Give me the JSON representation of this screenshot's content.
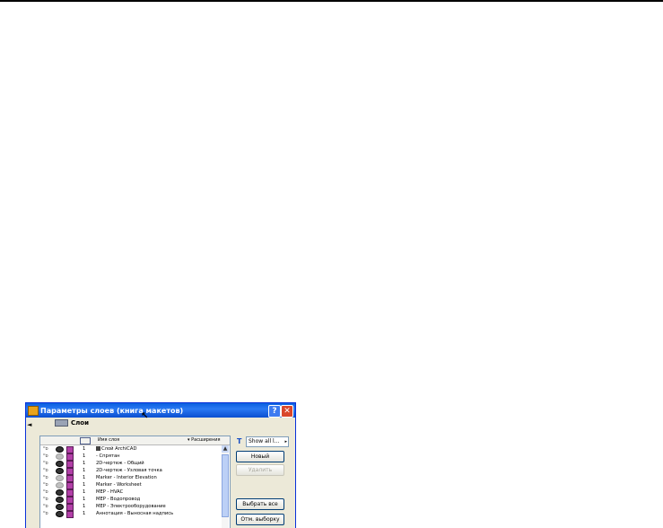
{
  "dialog": {
    "title": "Параметры слоев (книга макетов)",
    "help_label": "?",
    "close_label": "✕"
  },
  "panel": {
    "collapse_label": "◄",
    "layers_label": "Слои"
  },
  "list": {
    "header": {
      "name": "Имя слоя",
      "extensions": "Расширения"
    },
    "rows": [
      {
        "lock": "ᴼɒ",
        "visible": true,
        "number": "1",
        "name": "Слой ArchiCAD",
        "special": true
      },
      {
        "lock": "ᴼɒ",
        "visible": false,
        "number": "1",
        "name": "- Спрятан"
      },
      {
        "lock": "ᴼɒ",
        "visible": true,
        "number": "1",
        "name": "2D-чертеж - Общий"
      },
      {
        "lock": "ᴼɒ",
        "visible": true,
        "number": "1",
        "name": "2D-чертеж - Узловая точка"
      },
      {
        "lock": "ᴼɒ",
        "visible": false,
        "number": "1",
        "name": "Marker - Interior Elevation"
      },
      {
        "lock": "ᴼɒ",
        "visible": false,
        "number": "1",
        "name": "Marker - Worksheet"
      },
      {
        "lock": "ᴼɒ",
        "visible": true,
        "number": "1",
        "name": "MEP - HVAC"
      },
      {
        "lock": "ᴼɒ",
        "visible": true,
        "number": "1",
        "name": "MEP - Водопровод"
      },
      {
        "lock": "ᴼɒ",
        "visible": true,
        "number": "1",
        "name": "MEP - Электрооборудование"
      },
      {
        "lock": "ᴼɒ",
        "visible": true,
        "number": "1",
        "name": "Аннотация - Выносная надпись"
      }
    ]
  },
  "side": {
    "filter_value": "Show all l...",
    "new_label": "Новый",
    "delete_label": "Удалить",
    "select_all_label": "Выбрать все",
    "deselect_label": "Отм. выборку"
  }
}
